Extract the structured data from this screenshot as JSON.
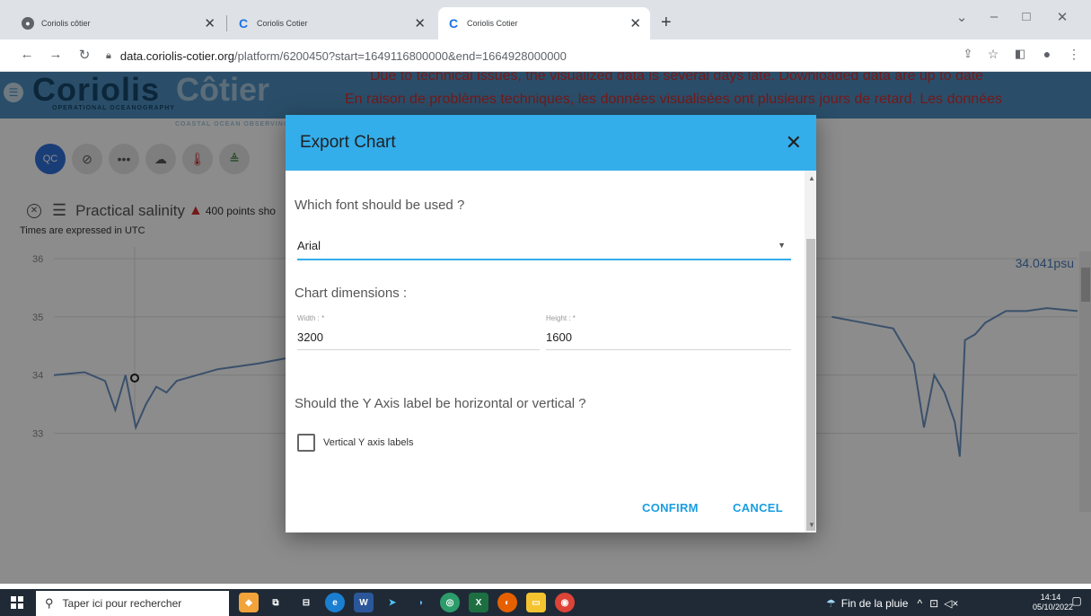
{
  "browser": {
    "tabs": [
      {
        "title": "Coriolis côtier",
        "icon": "globe-icon"
      },
      {
        "title": "Coriolis Cotier",
        "icon": "coriolis-c-icon"
      },
      {
        "title": "Coriolis Cotier",
        "icon": "coriolis-c-icon",
        "active": true
      }
    ],
    "new_tab": "+",
    "url_host": "data.coriolis-cotier.org",
    "url_path": "/platform/6200450?start=1649116800000&end=1664928000000",
    "window_controls": [
      "⌄",
      "–",
      "□",
      "✕"
    ]
  },
  "site": {
    "logo_main": "Coriolis",
    "logo_accent": "Côtier",
    "logo_sub1": "OPERATIONAL OCEANOGRAPHY",
    "logo_sub2": "COASTAL OCEAN OBSERVING S",
    "banner_en": "Due to technical issues, the visualized data is several days late. Downloaded data are up to date",
    "banner_fr": "En raison de problèmes techniques, les données visualisées ont plusieurs jours de retard. Les données",
    "toolbar_buttons": [
      {
        "label": "QC",
        "icon": "qc-icon"
      },
      {
        "label": "",
        "icon": "eye-off-icon"
      },
      {
        "label": "",
        "icon": "dots-icon"
      },
      {
        "label": "",
        "icon": "cloud-download-icon"
      },
      {
        "label": "",
        "icon": "thermometer-icon"
      },
      {
        "label": "",
        "icon": "water-level-icon"
      }
    ],
    "chart_title": "Practical salinity",
    "chart_warning": "400 points sho",
    "utc_note": "Times are expressed in UTC",
    "last_value": "34.041psu"
  },
  "chart_data": {
    "type": "line",
    "title": "Practical salinity",
    "ylabel": "",
    "ylim": [
      32.5,
      36.2
    ],
    "y_ticks": [
      "36",
      "35",
      "34",
      "33"
    ],
    "series": [
      {
        "color": "#6b93c4",
        "segments": [
          {
            "x": [
              0.0,
              0.03,
              0.05,
              0.06,
              0.07,
              0.08,
              0.09,
              0.1,
              0.11,
              0.12,
              0.14,
              0.16,
              0.18,
              0.2,
              0.23,
              0.26,
              0.29
            ],
            "y": [
              34.0,
              34.05,
              33.9,
              33.4,
              34.0,
              33.1,
              33.5,
              33.8,
              33.7,
              33.9,
              34.0,
              34.1,
              34.15,
              34.2,
              34.3,
              34.35,
              34.4
            ]
          },
          {
            "x": [
              0.76,
              0.79,
              0.82,
              0.84,
              0.85,
              0.86,
              0.87,
              0.88,
              0.885,
              0.89,
              0.9,
              0.91,
              0.93,
              0.95,
              0.97,
              1.0
            ],
            "y": [
              35.0,
              34.9,
              34.8,
              34.2,
              33.1,
              34.0,
              33.7,
              33.2,
              32.6,
              34.6,
              34.7,
              34.9,
              35.1,
              35.1,
              35.15,
              35.1
            ]
          }
        ]
      }
    ]
  },
  "modal": {
    "title": "Export Chart",
    "close": "✕",
    "font_question": "Which font should be used ?",
    "font_value": "Arial",
    "dimensions_label": "Chart dimensions :",
    "width_label": "Width : *",
    "width_value": "3200",
    "height_label": "Height : *",
    "height_value": "1600",
    "axis_question": "Should the Y Axis label be horizontal or vertical ?",
    "checkbox_label": "Vertical Y axis labels",
    "checkbox_checked": false,
    "confirm": "CONFIRM",
    "cancel": "CANCEL"
  },
  "taskbar": {
    "search_placeholder": "Taper ici pour rechercher",
    "weather": "Fin de la pluie",
    "time": "14:14",
    "date": "05/10/2022"
  }
}
